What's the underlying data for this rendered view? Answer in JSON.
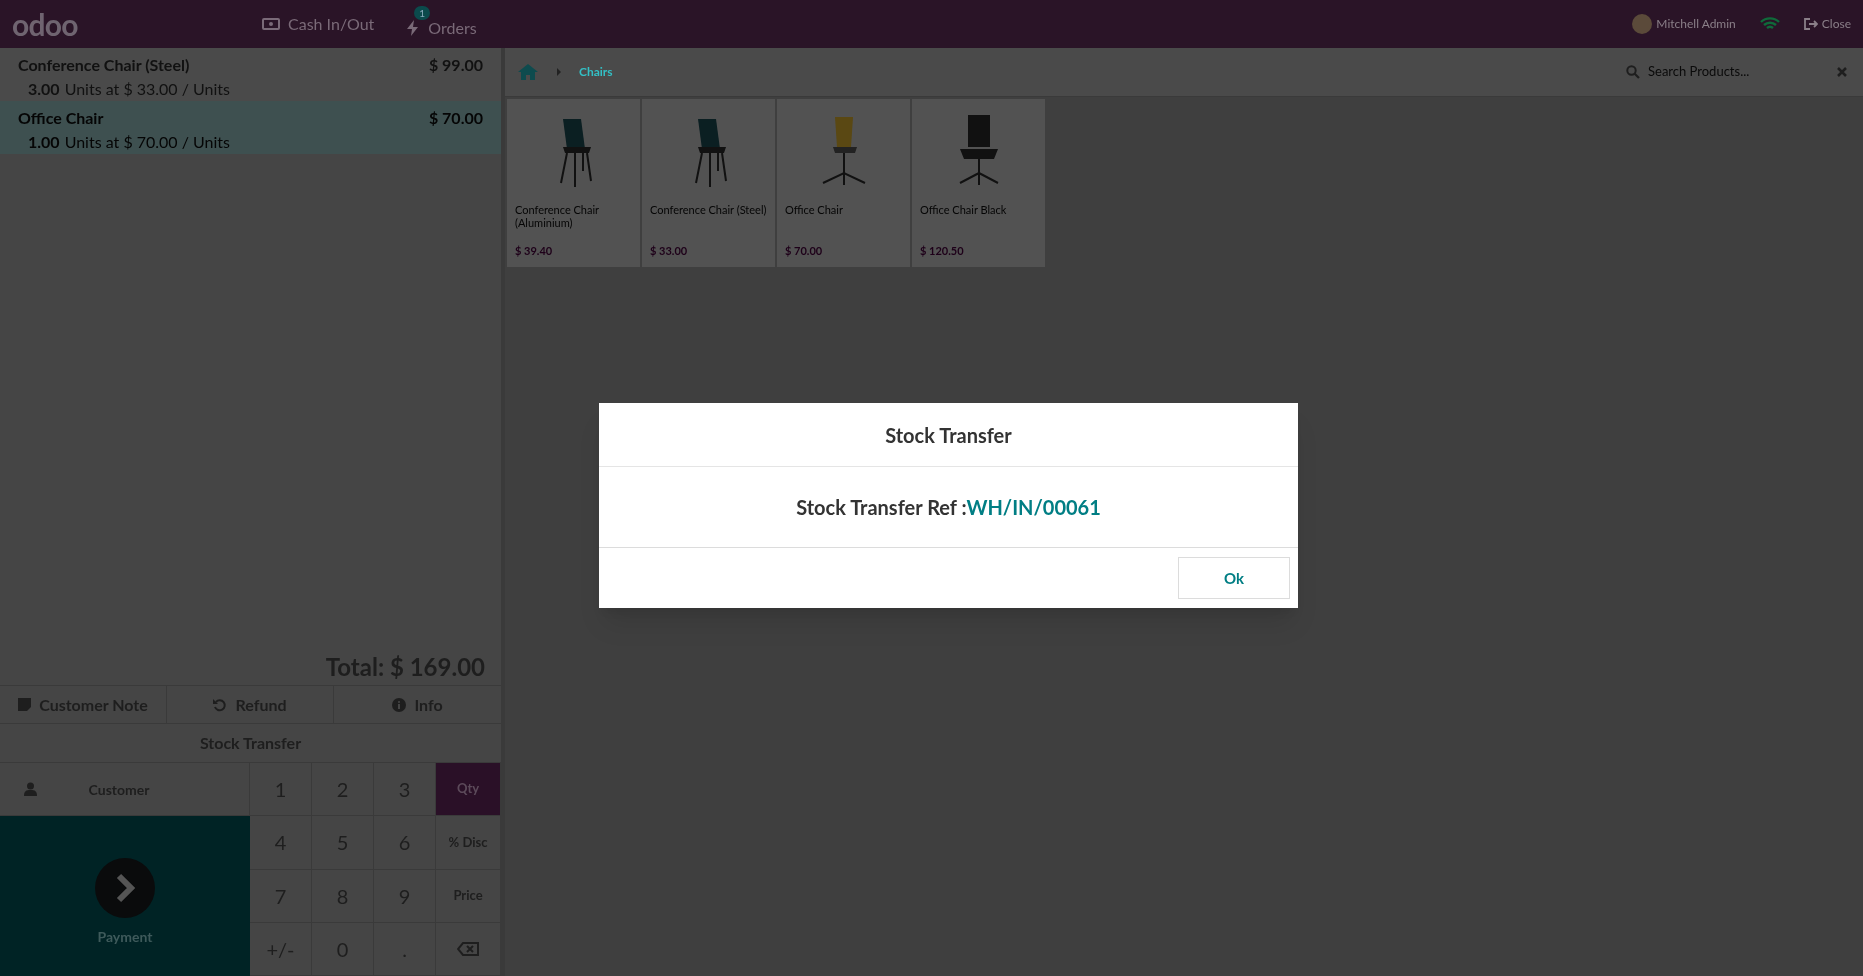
{
  "top_bar": {
    "logo": "odoo",
    "buttons": [
      {
        "label": "Cash In/Out",
        "kind": "cash"
      },
      {
        "label": "Orders",
        "kind": "orders",
        "badge": "1"
      }
    ],
    "user": "Mitchell Admin",
    "close": "Close"
  },
  "order_lines": [
    {
      "name": "Conference Chair (Steel)",
      "price": "$ 99.00",
      "quantity": "3.00",
      "detail": "Units at $ 33.00 / Units",
      "selected": false
    },
    {
      "name": "Office Chair",
      "price": "$ 70.00",
      "quantity": "1.00",
      "detail": "Units at $ 70.00 / Units",
      "selected": true
    }
  ],
  "total": "Total: $ 169.00",
  "control_buttons": [
    {
      "label": "Customer Note",
      "kind": "note"
    },
    {
      "label": "Refund",
      "kind": "refund"
    },
    {
      "label": "Info",
      "kind": "info"
    }
  ],
  "stock_transfer_button": "Stock Transfer",
  "customer_button": "Customer",
  "payment_button": "Payment",
  "numpad": [
    {
      "label": "1",
      "selected": false
    },
    {
      "label": "2",
      "selected": false
    },
    {
      "label": "3",
      "selected": false
    },
    {
      "label": "Qty",
      "kind": "mode",
      "selected": true
    },
    {
      "label": "4",
      "selected": false
    },
    {
      "label": "5",
      "selected": false
    },
    {
      "label": "6",
      "selected": false
    },
    {
      "label": "% Disc",
      "kind": "mode",
      "selected": false
    },
    {
      "label": "7",
      "selected": false
    },
    {
      "label": "8",
      "selected": false
    },
    {
      "label": "9",
      "selected": false
    },
    {
      "label": "Price",
      "kind": "mode",
      "selected": false
    },
    {
      "label": "+/-",
      "selected": false
    },
    {
      "label": "0",
      "selected": false
    },
    {
      "label": ".",
      "selected": false
    },
    {
      "kind": "backspace",
      "selected": false
    }
  ],
  "breadcrumb": [
    "Chairs"
  ],
  "search": {
    "placeholder": "Search Products..."
  },
  "products": [
    {
      "name": "Conference Chair (Aluminium)",
      "price": "$ 39.40",
      "kind": "dark"
    },
    {
      "name": "Conference Chair (Steel)",
      "price": "$ 33.00",
      "kind": "dark"
    },
    {
      "name": "Office Chair",
      "price": "$ 70.00",
      "kind": "yellow"
    },
    {
      "name": "Office Chair Black",
      "price": "$ 120.50",
      "kind": "black"
    }
  ],
  "dialog": {
    "title": "Stock Transfer",
    "ref_label": "Stock Transfer Ref :",
    "ref_value": "WH/IN/00061",
    "button": "Ok"
  }
}
